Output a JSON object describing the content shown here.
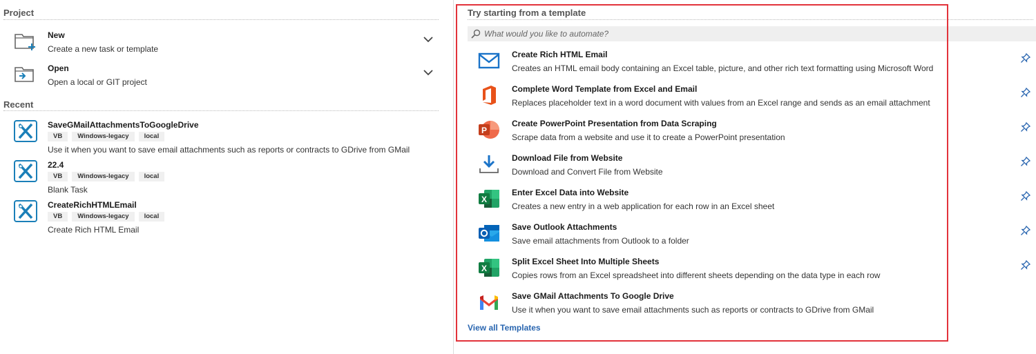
{
  "project": {
    "header": "Project",
    "actions": [
      {
        "title": "New",
        "desc": "Create a new task or template",
        "icon": "new-folder-icon"
      },
      {
        "title": "Open",
        "desc": "Open a local or GIT project",
        "icon": "open-folder-icon"
      }
    ]
  },
  "recent": {
    "header": "Recent",
    "items": [
      {
        "title": "SaveGMailAttachmentsToGoogleDrive",
        "tags": [
          "VB",
          "Windows-legacy",
          "local"
        ],
        "desc": "Use it when you want to save email attachments such as reports or contracts to GDrive from GMail"
      },
      {
        "title": "22.4",
        "tags": [
          "VB",
          "Windows-legacy",
          "local"
        ],
        "desc": "Blank Task"
      },
      {
        "title": "CreateRichHTMLEmail",
        "tags": [
          "VB",
          "Windows-legacy",
          "local"
        ],
        "desc": "Create Rich HTML Email"
      }
    ]
  },
  "templates": {
    "header": "Try starting from a template",
    "search_placeholder": "What would you like to automate?",
    "items": [
      {
        "title": "Create Rich HTML Email",
        "desc": "Creates an HTML email body containing an Excel table, picture, and other rich text formatting using Microsoft Word",
        "icon": "mail-icon",
        "pinned": true
      },
      {
        "title": "Complete Word Template from Excel and Email",
        "desc": "Replaces placeholder text in a word document with values from an Excel range and sends as an email attachment",
        "icon": "office-icon",
        "pinned": true
      },
      {
        "title": "Create PowerPoint Presentation from Data Scraping",
        "desc": "Scrape data from a website and use it to create a PowerPoint presentation",
        "icon": "powerpoint-icon",
        "pinned": true
      },
      {
        "title": "Download File from Website",
        "desc": "Download and Convert File from Website",
        "icon": "download-icon",
        "pinned": true
      },
      {
        "title": "Enter Excel Data into Website",
        "desc": "Creates a new entry in a web application for each row in an Excel sheet",
        "icon": "excel-icon",
        "pinned": true
      },
      {
        "title": "Save Outlook Attachments",
        "desc": "Save email attachments from Outlook to a folder",
        "icon": "outlook-icon",
        "pinned": true
      },
      {
        "title": "Split Excel Sheet Into Multiple Sheets",
        "desc": "Copies rows from an Excel spreadsheet into different sheets depending on the data type in each row",
        "icon": "excel-icon",
        "pinned": true
      },
      {
        "title": "Save GMail Attachments To Google Drive",
        "desc": "Use it when you want to save email attachments such as reports or contracts to GDrive from GMail",
        "icon": "gmail-icon",
        "pinned": false
      }
    ],
    "view_all": "View all Templates"
  },
  "colors": {
    "accent_link": "#2a66b0",
    "highlight_border": "#e2323a",
    "studio_icon": "#1a7fb8"
  }
}
